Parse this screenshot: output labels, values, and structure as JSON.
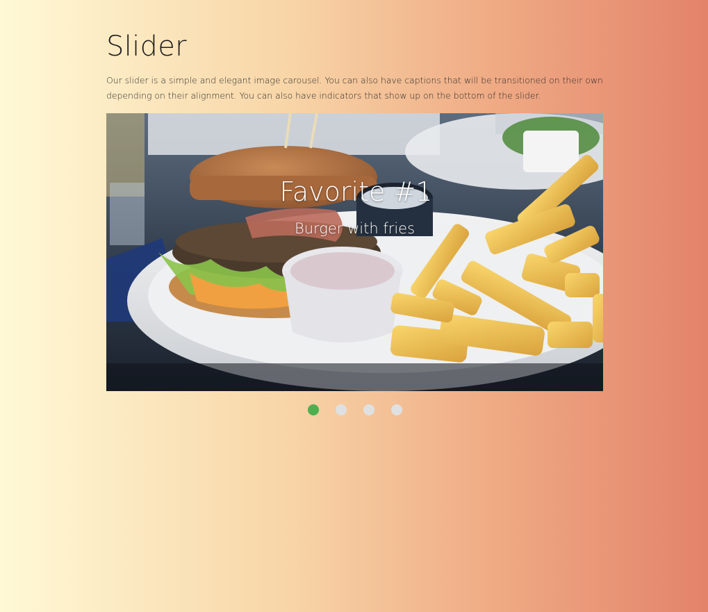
{
  "page": {
    "title": "Slider",
    "description": "Our slider is a simple and elegant image carousel. You can also have captions that will be transitioned on their own depending on their alignment. You can also have indicators that show up on the bottom of the slider."
  },
  "slider": {
    "active_index": 0,
    "slides": [
      {
        "caption_title": "Favorite #1",
        "caption_subtitle": "Burger with fries",
        "image": "burger-with-fries-photo"
      }
    ],
    "indicator_count": 4,
    "colors": {
      "active_indicator": "#4caf50",
      "inactive_indicator": "#e0e0e0"
    }
  },
  "colors": {
    "background_gradient": [
      "#fff9d6",
      "#f8d6a8",
      "#efaa84",
      "#e3836a"
    ]
  }
}
